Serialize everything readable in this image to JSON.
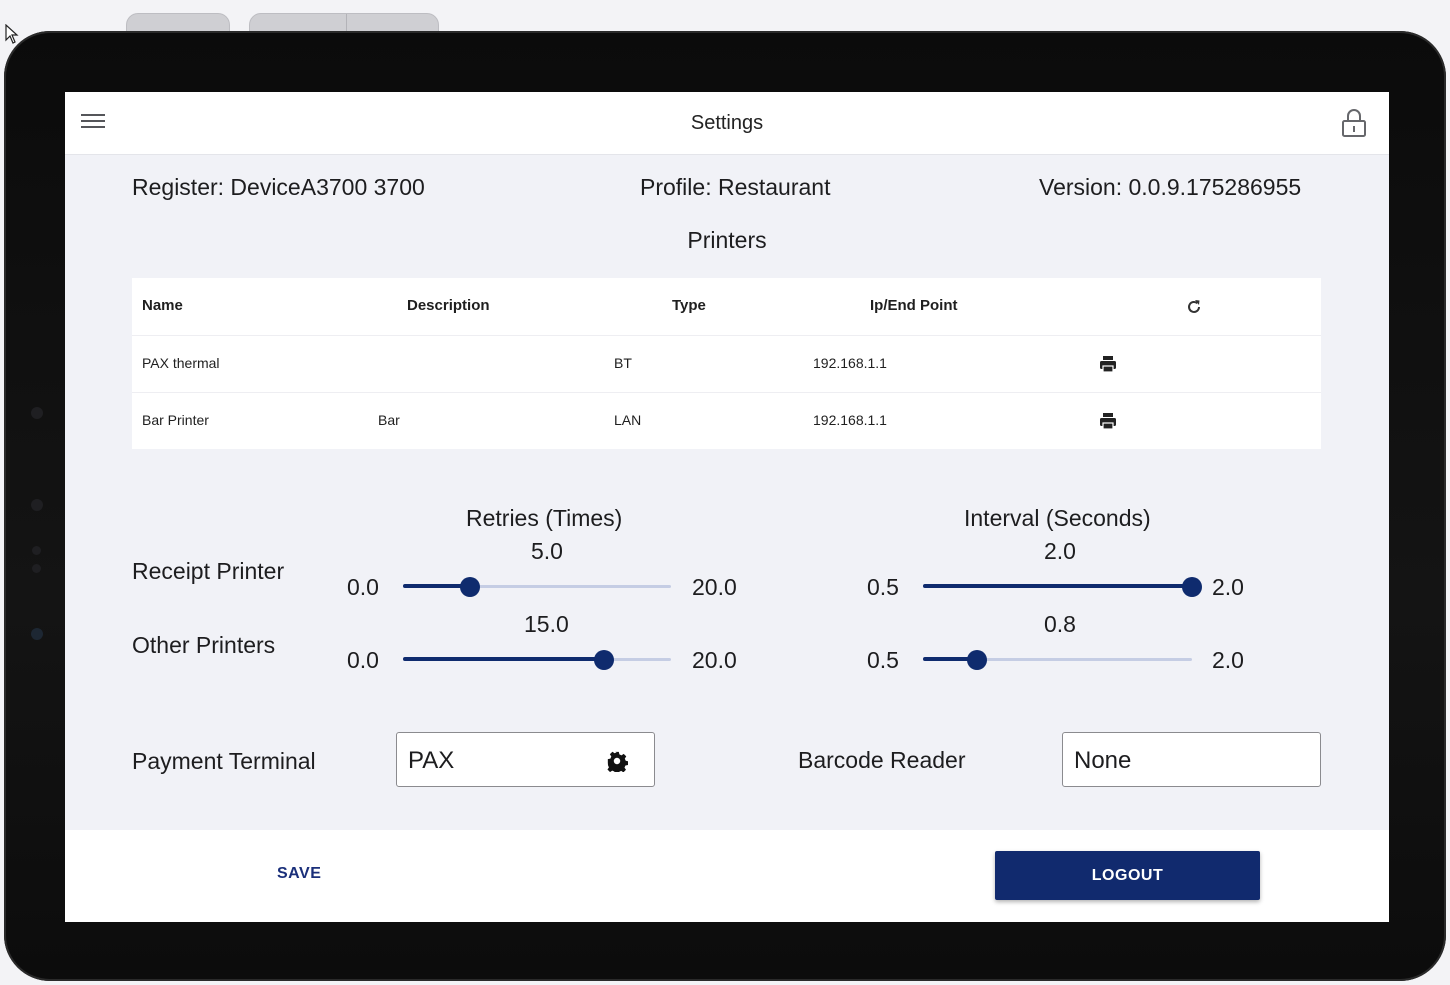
{
  "app": {
    "title": "Settings",
    "register": "Register: DeviceA3700 3700",
    "profile": "Profile: Restaurant",
    "version": "Version: 0.0.9.175286955"
  },
  "printers": {
    "section_title": "Printers",
    "columns": [
      "Name",
      "Description",
      "Type",
      "Ip/End Point"
    ],
    "rows": [
      {
        "name": "PAX thermal",
        "description": "",
        "type": "BT",
        "ip": "192.168.1.1"
      },
      {
        "name": "Bar Printer",
        "description": "Bar",
        "type": "LAN",
        "ip": "192.168.1.1"
      }
    ]
  },
  "retries": {
    "title": "Retries (Times)",
    "receipt": {
      "value": "5.0",
      "min": "0.0",
      "max": "20.0",
      "fraction": 0.25
    },
    "other": {
      "value": "15.0",
      "min": "0.0",
      "max": "20.0",
      "fraction": 0.75
    }
  },
  "interval": {
    "title": "Interval (Seconds)",
    "receipt": {
      "value": "2.0",
      "min": "0.5",
      "max": "2.0",
      "fraction": 1.0
    },
    "other": {
      "value": "0.8",
      "min": "0.5",
      "max": "2.0",
      "fraction": 0.2
    }
  },
  "rows_labels": {
    "receipt_printer": "Receipt Printer",
    "other_printers": "Other Printers"
  },
  "devices": {
    "payment_label": "Payment Terminal",
    "payment_value": "PAX",
    "barcode_label": "Barcode Reader",
    "barcode_value": "None"
  },
  "footer": {
    "save_label": "SAVE",
    "logout_label": "LOGOUT"
  },
  "colors": {
    "accent": "#112a6e",
    "track": "#c5cde4",
    "background": "#f1f2f7"
  }
}
